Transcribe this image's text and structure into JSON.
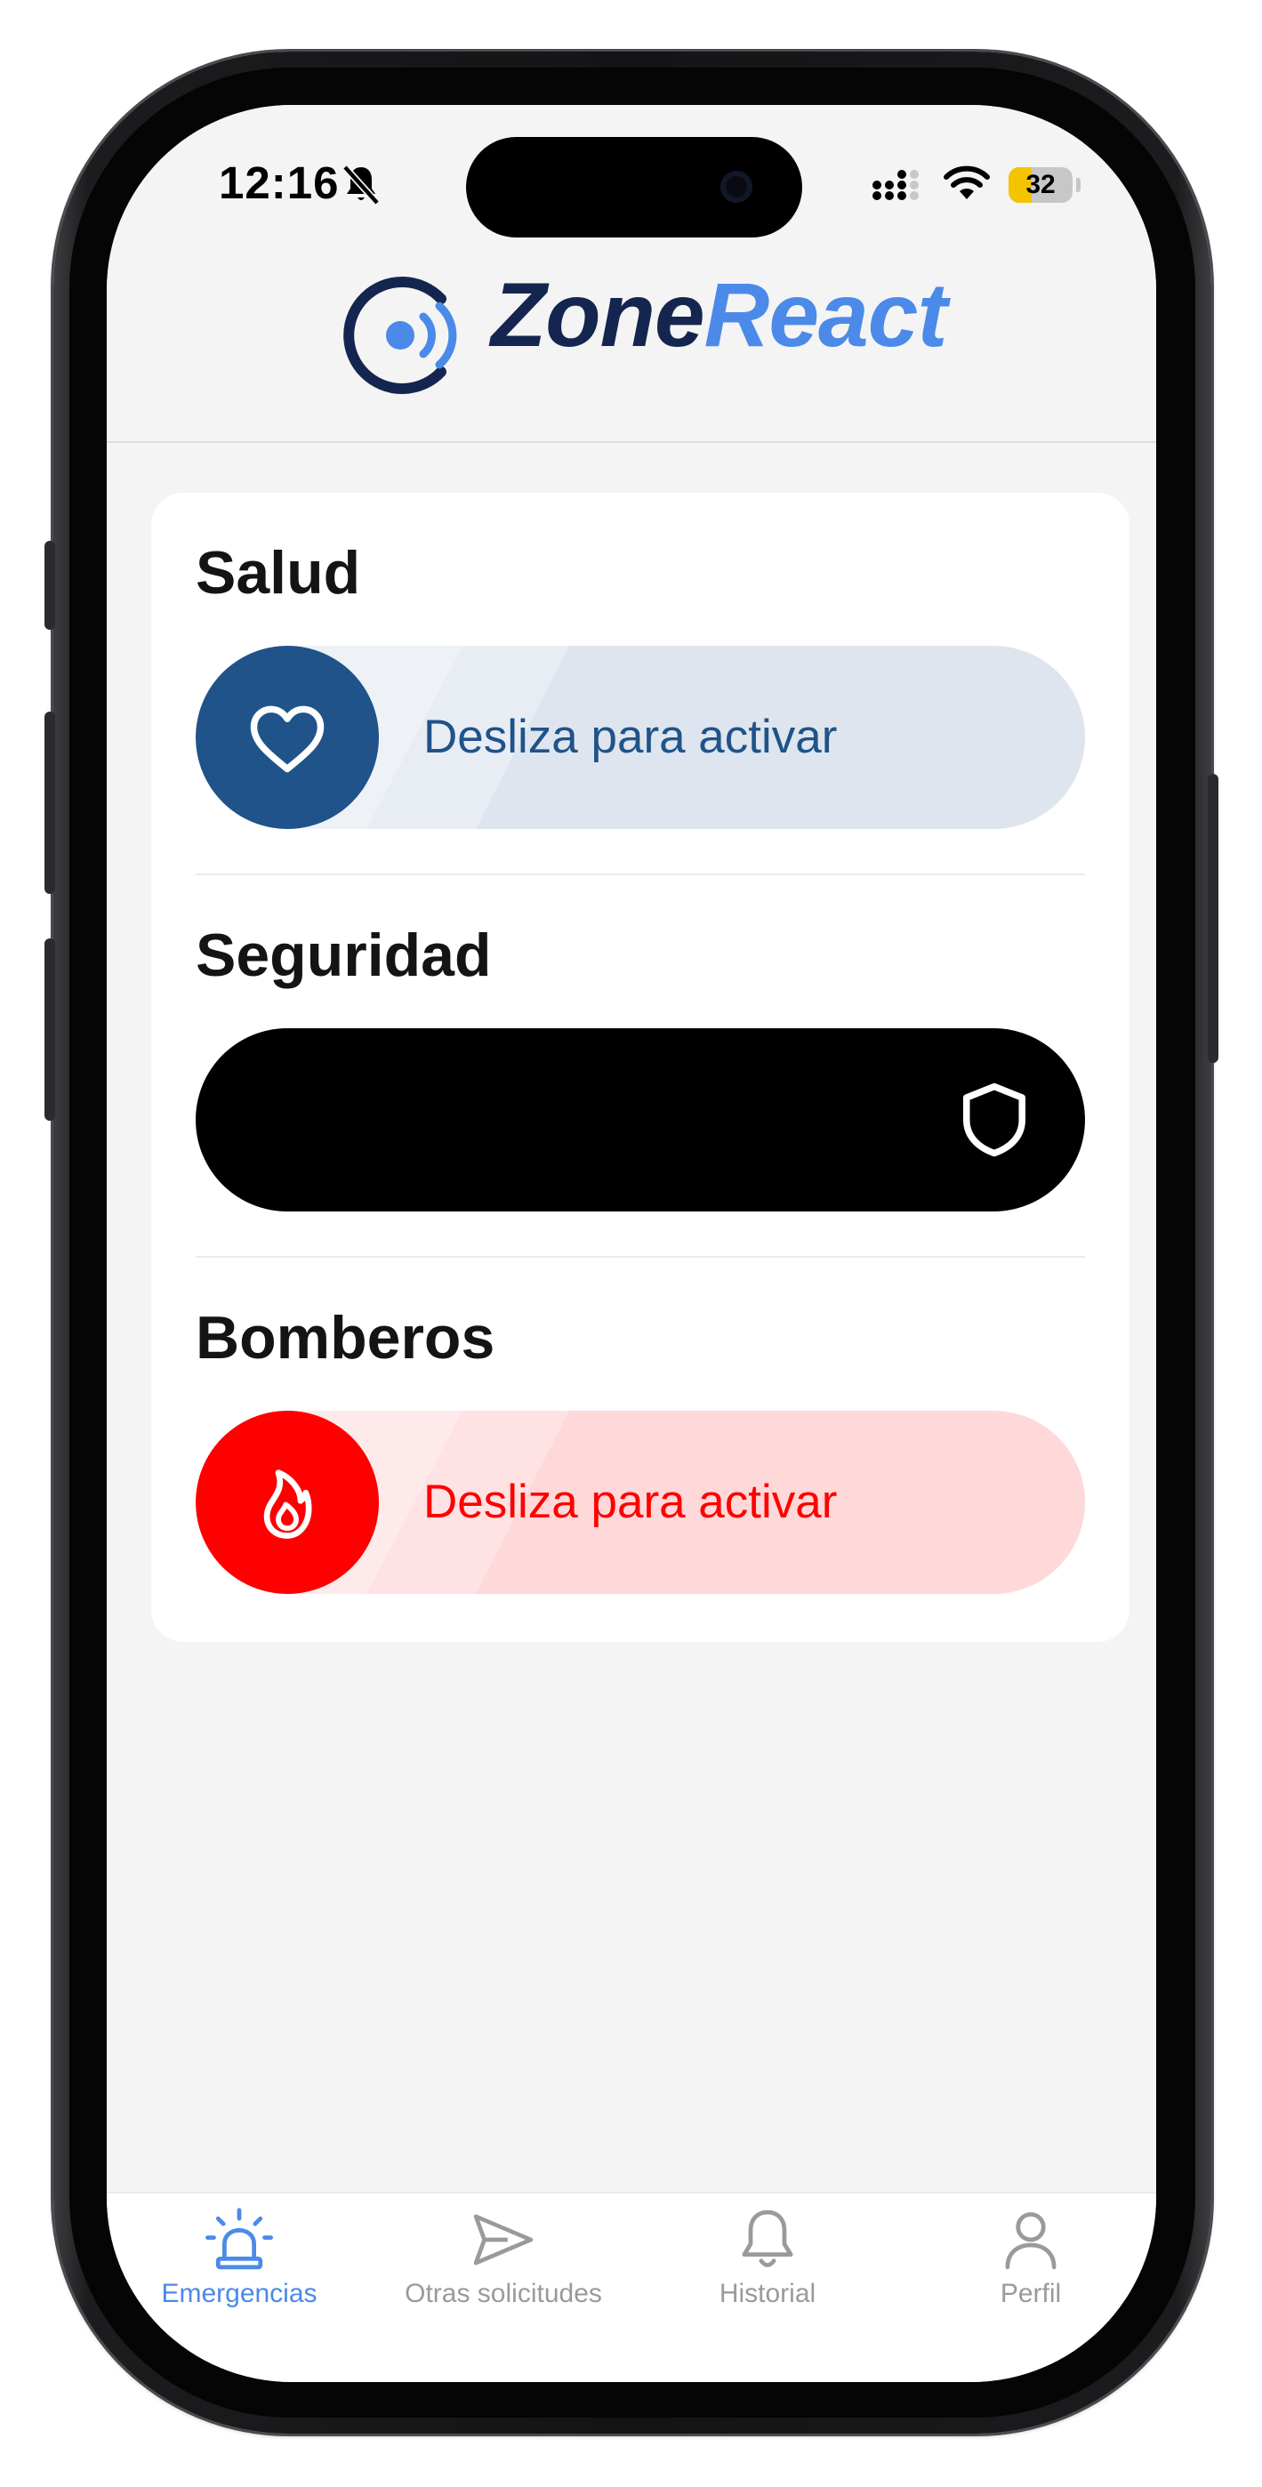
{
  "status_bar": {
    "time": "12:16",
    "battery": "32"
  },
  "app": {
    "logo_part1": "Zone",
    "logo_part2": "React"
  },
  "sections": [
    {
      "title": "Salud",
      "slider_label": "Desliza para activar",
      "icon": "heart-icon",
      "accent": "#1f538a",
      "track": "#dfe5ee"
    },
    {
      "title": "Seguridad",
      "slider_label": "",
      "icon": "shield-icon",
      "accent": "#000000",
      "track": "#000000"
    },
    {
      "title": "Bomberos",
      "slider_label": "Desliza para activar",
      "icon": "flame-icon",
      "accent": "#ff0000",
      "track": "#ffd8d9"
    }
  ],
  "tabs": [
    {
      "label": "Emergencias",
      "icon": "siren-icon",
      "active": true
    },
    {
      "label": "Otras solicitudes",
      "icon": "send-icon",
      "active": false
    },
    {
      "label": "Historial",
      "icon": "bell-icon",
      "active": false
    },
    {
      "label": "Perfil",
      "icon": "user-icon",
      "active": false
    }
  ],
  "colors": {
    "tab_active": "#4b8ae8",
    "tab_inactive": "#9a9a9a",
    "logo_dark": "#14264f",
    "logo_blue": "#4b8ae8"
  }
}
